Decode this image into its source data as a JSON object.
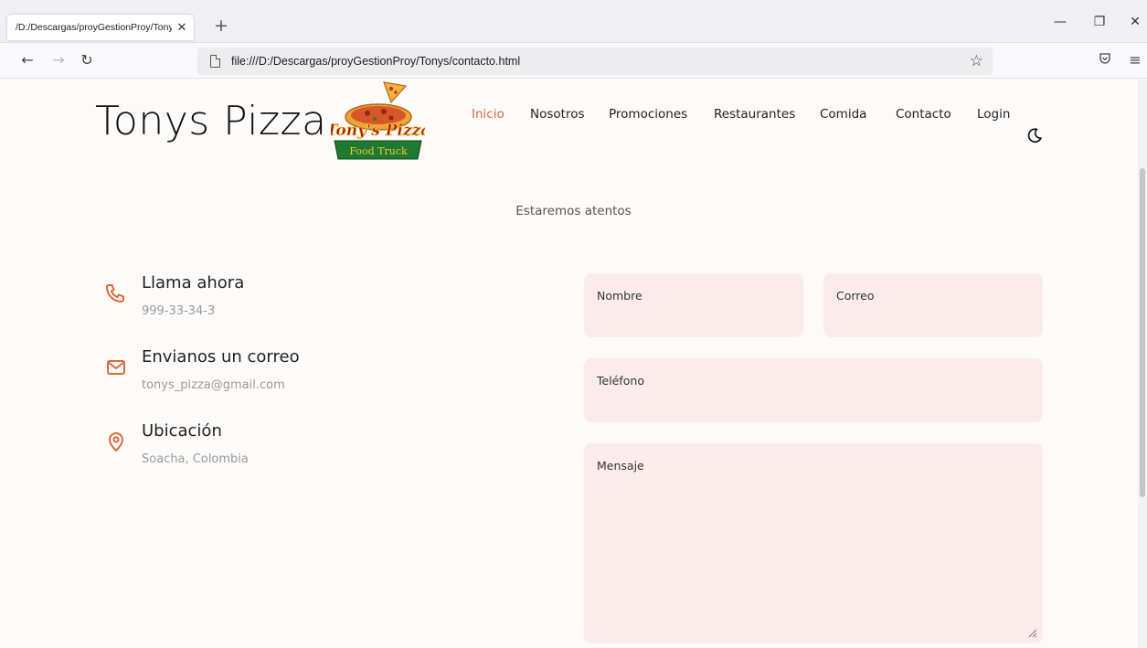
{
  "browser": {
    "tab_title": "/D:/Descargas/proyGestionProy/Tonys",
    "url": "file:///D:/Descargas/proyGestionProy/Tonys/contacto.html"
  },
  "header": {
    "site_title": "Tonys Pizza",
    "logo_alt": "Tonys Pizza Food Truck",
    "menu": [
      "Inicio",
      "Nosotros",
      "Promociones",
      "Restaurantes",
      "Comida",
      "Contacto",
      "Login"
    ],
    "accent_color": "#d96a3b"
  },
  "contact": {
    "subtitle": "Estaremos atentos",
    "phone": {
      "title": "Llama ahora",
      "value": "999-33-34-3",
      "icon": "phone-icon"
    },
    "email": {
      "title": "Envianos un correo",
      "value": "tonys_pizza@gmail.com",
      "icon": "mail-icon"
    },
    "location": {
      "title": "Ubicación",
      "value": "Soacha, Colombia",
      "icon": "location-pin-icon"
    }
  },
  "form": {
    "name_label": "Nombre",
    "email_label": "Correo",
    "phone_label": "Teléfono",
    "message_label": "Mensaje"
  }
}
